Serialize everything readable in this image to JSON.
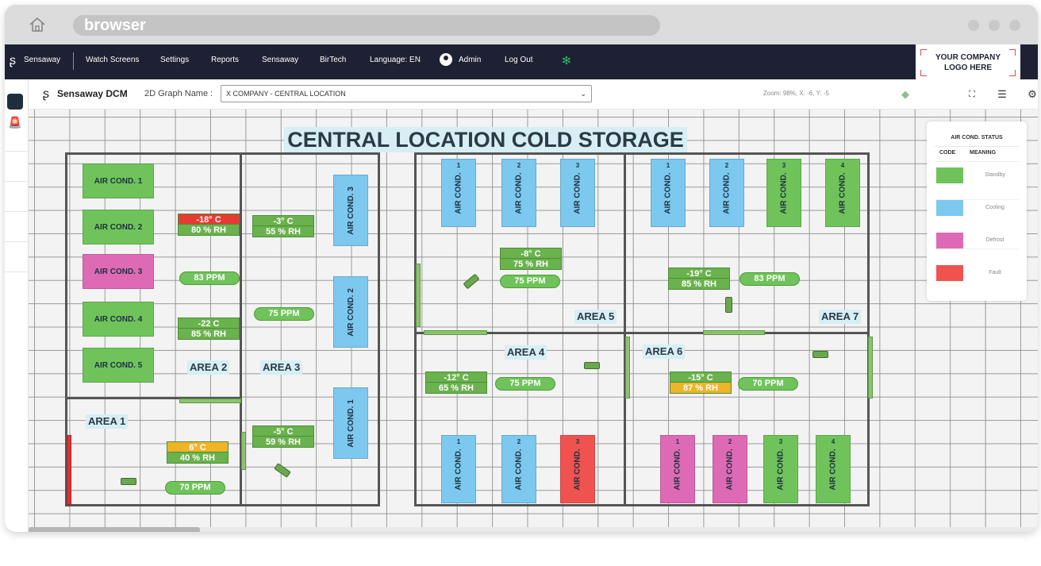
{
  "browser": {
    "url_label": "browser"
  },
  "nav": {
    "brand": "Sensaway",
    "items": [
      "Watch Screens",
      "Settings",
      "Reports",
      "Sensaway",
      "BirTech",
      "Language: EN"
    ],
    "admin": "Admin",
    "logout": "Log Out"
  },
  "logo": {
    "line1": "YOUR COMPANY",
    "line2": "LOGO HERE"
  },
  "toolbar": {
    "app_title": "Sensaway DCM",
    "graph_label": "2D Graph Name :",
    "graph_value": "X COMPANY - CENTRAL LOCATION",
    "zoom": "Zoom: 98%, X: -6, Y: -5"
  },
  "canvas": {
    "title": "CENTRAL LOCATION COLD STORAGE",
    "areas": [
      "AREA 1",
      "AREA 2",
      "AREA 3",
      "AREA 4",
      "AREA 5",
      "AREA 6",
      "AREA 7"
    ],
    "ac_left": [
      {
        "label": "AIR COND. 1",
        "status": "standby"
      },
      {
        "label": "AIR COND. 2",
        "status": "standby"
      },
      {
        "label": "AIR COND. 3",
        "status": "defrost"
      },
      {
        "label": "AIR COND. 4",
        "status": "standby"
      },
      {
        "label": "AIR COND. 5",
        "status": "standby"
      }
    ],
    "ac_mid": [
      {
        "label": "AIR COND. 3",
        "status": "cooling"
      },
      {
        "label": "AIR COND. 2",
        "status": "cooling"
      },
      {
        "label": "AIR COND. 1",
        "status": "cooling"
      }
    ],
    "ac_top_5": [
      {
        "label": "AIR COND.",
        "num": "1",
        "status": "cooling"
      },
      {
        "label": "AIR COND.",
        "num": "2",
        "status": "cooling"
      },
      {
        "label": "AIR COND.",
        "num": "3",
        "status": "cooling"
      }
    ],
    "ac_top_7": [
      {
        "label": "AIR COND.",
        "num": "1",
        "status": "cooling"
      },
      {
        "label": "AIR COND.",
        "num": "2",
        "status": "cooling"
      },
      {
        "label": "AIR COND.",
        "num": "3",
        "status": "standby"
      },
      {
        "label": "AIR COND.",
        "num": "4",
        "status": "standby"
      }
    ],
    "ac_bot_4": [
      {
        "label": "AIR COND.",
        "num": "1",
        "status": "cooling"
      },
      {
        "label": "AIR COND.",
        "num": "2",
        "status": "cooling"
      },
      {
        "label": "AIR COND.",
        "num": "3",
        "status": "fault"
      }
    ],
    "ac_bot_6": [
      {
        "label": "AIR COND.",
        "num": "1",
        "status": "defrost"
      },
      {
        "label": "AIR COND.",
        "num": "2",
        "status": "defrost"
      },
      {
        "label": "AIR COND.",
        "num": "3",
        "status": "standby"
      },
      {
        "label": "AIR COND.",
        "num": "4",
        "status": "standby"
      }
    ],
    "readings": [
      {
        "temp": "-18° C",
        "rh": "80 % RH",
        "temp_state": "fault"
      },
      {
        "temp": "-3° C",
        "rh": "55 % RH",
        "temp_state": "ok"
      },
      {
        "temp": "-22 C",
        "rh": "85 % RH",
        "temp_state": "ok"
      },
      {
        "temp": "6° C",
        "rh": "40 % RH",
        "temp_state": "warn"
      },
      {
        "temp": "-5° C",
        "rh": "59 % RH",
        "temp_state": "ok"
      },
      {
        "temp": "-8° C",
        "rh": "75 % RH",
        "temp_state": "ok"
      },
      {
        "temp": "-19° C",
        "rh": "85 % RH",
        "temp_state": "ok"
      },
      {
        "temp": "-12° C",
        "rh": "65 % RH",
        "temp_state": "ok"
      },
      {
        "temp": "-15° C",
        "rh": "87 % RH",
        "temp_state": "ok",
        "rh_state": "warn"
      }
    ],
    "ppm": [
      "83 PPM",
      "75 PPM",
      "70 PPM",
      "75 PPM",
      "83 PPM",
      "75 PPM",
      "70 PPM"
    ]
  },
  "legend": {
    "title": "AIR COND. STATUS",
    "col_code": "CODE",
    "col_meaning": "MEANING",
    "rows": [
      {
        "meaning": "Standby",
        "color": "#6fc35a"
      },
      {
        "meaning": "Cooling",
        "color": "#7cc8ef"
      },
      {
        "meaning": "Defrost",
        "color": "#de6ab6"
      },
      {
        "meaning": "Fault",
        "color": "#f0534f"
      }
    ]
  },
  "icons": [
    "home-icon",
    "brand-icon",
    "admin-icon",
    "settings-gear-icon",
    "dcm-logo-icon",
    "chevron-down-icon",
    "layers-icon",
    "fullscreen-icon",
    "list-icon",
    "settings-icon",
    "siren-icon"
  ]
}
